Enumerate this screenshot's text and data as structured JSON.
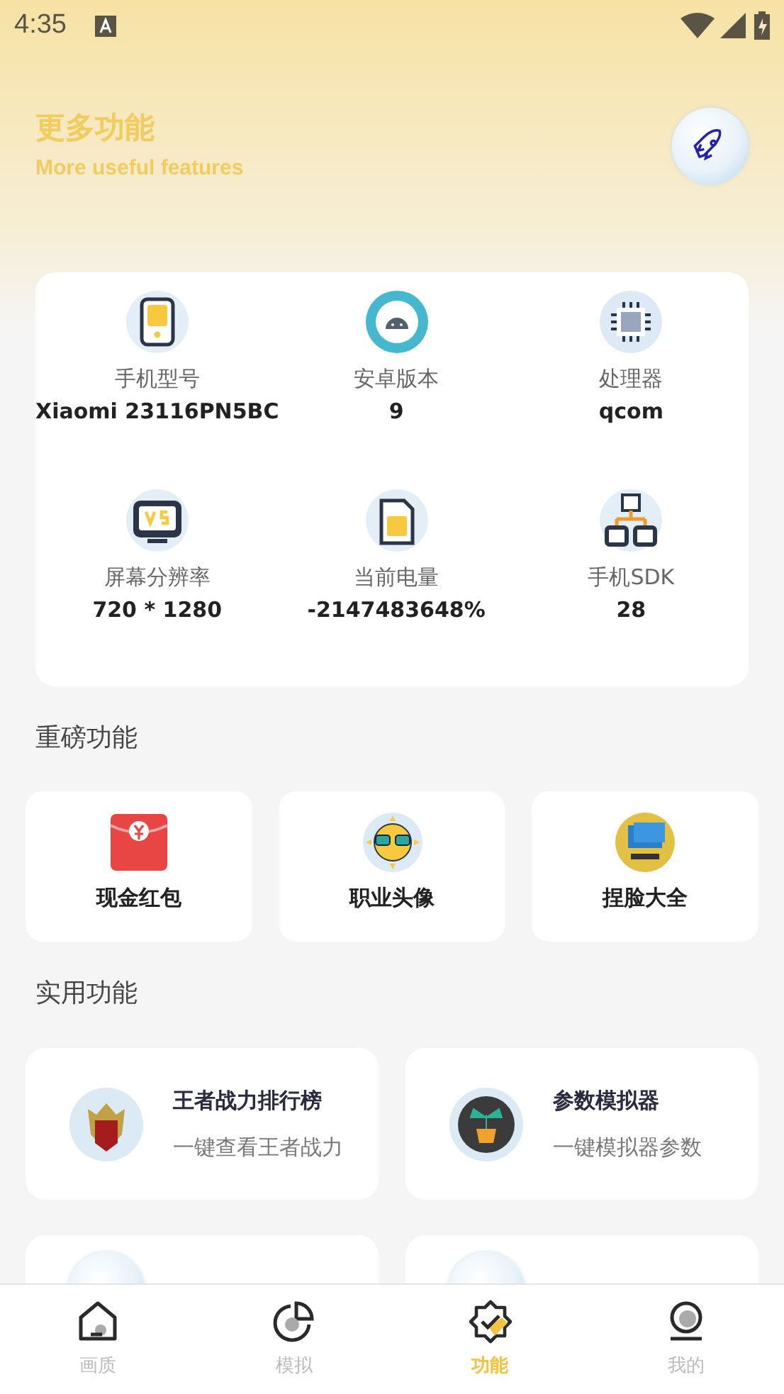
{
  "status_bar": {
    "time": "4:35"
  },
  "header": {
    "title": "更多功能",
    "subtitle": "More useful features"
  },
  "device_info": [
    {
      "kind": "phone",
      "label": "手机型号",
      "value": "Xiaomi 23116PN5BC"
    },
    {
      "kind": "android",
      "label": "安卓版本",
      "value": "9"
    },
    {
      "kind": "chip",
      "label": "处理器",
      "value": "qcom"
    },
    {
      "kind": "monitor",
      "label": "屏幕分辨率",
      "value": "720 * 1280"
    },
    {
      "kind": "battery",
      "label": "当前电量",
      "value": "-2147483648%"
    },
    {
      "kind": "network",
      "label": "手机SDK",
      "value": "28"
    }
  ],
  "featured": {
    "heading": "重磅功能",
    "items": [
      {
        "kind": "envelope",
        "label": "现金红包"
      },
      {
        "kind": "sun",
        "label": "职业头像"
      },
      {
        "kind": "computer",
        "label": "捏脸大全"
      }
    ]
  },
  "utilities": {
    "heading": "实用功能",
    "items": [
      {
        "kind": "helmet",
        "title": "王者战力排行榜",
        "subtitle": "一键查看王者战力"
      },
      {
        "kind": "plant",
        "title": "参数模拟器",
        "subtitle": "一键模拟器参数"
      },
      {
        "kind": "bubble"
      },
      {
        "kind": "bubble"
      }
    ]
  },
  "bottom_nav": [
    {
      "kind": "home",
      "label": "画质",
      "selected": false
    },
    {
      "kind": "pie",
      "label": "模拟",
      "selected": false
    },
    {
      "kind": "badge",
      "label": "功能",
      "selected": true
    },
    {
      "kind": "user",
      "label": "我的",
      "selected": false
    }
  ]
}
